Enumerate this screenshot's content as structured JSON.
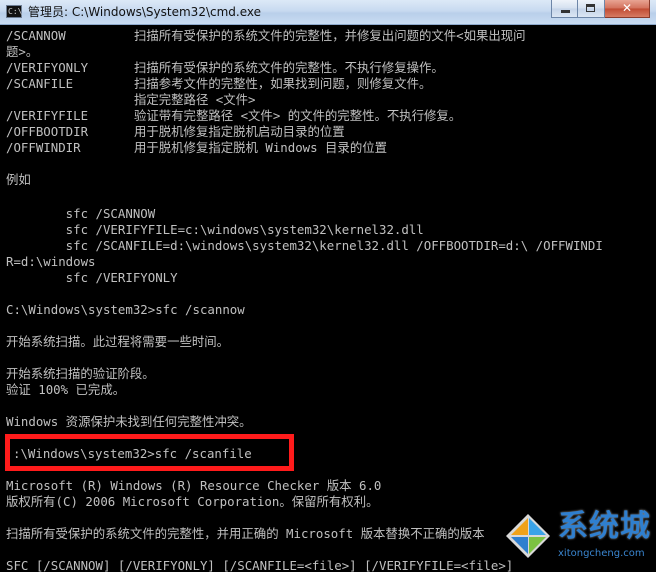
{
  "window": {
    "title": "管理员: C:\\Windows\\System32\\cmd.exe",
    "icon_label": "C:\\"
  },
  "console": {
    "options": [
      {
        "switch": "/SCANNOW",
        "desc": "扫描所有受保护的系统文件的完整性，并修复出问题的文件<如果出现问"
      },
      {
        "switch": "",
        "desc": "题>。"
      },
      {
        "switch": "/VERIFYONLY",
        "desc": "扫描所有受保护的系统文件的完整性。不执行修复操作。"
      },
      {
        "switch": "/SCANFILE",
        "desc": "扫描参考文件的完整性，如果找到问题，则修复文件。"
      },
      {
        "switch": "",
        "desc": "指定完整路径 <文件>"
      },
      {
        "switch": "/VERIFYFILE",
        "desc": "验证带有完整路径 <文件> 的文件的完整性。不执行修复。"
      },
      {
        "switch": "/OFFBOOTDIR",
        "desc": "用于脱机修复指定脱机启动目录的位置"
      },
      {
        "switch": "/OFFWINDIR",
        "desc": "用于脱机修复指定脱机 Windows 目录的位置"
      }
    ],
    "example_heading": "例如",
    "examples": [
      "        sfc /SCANNOW",
      "        sfc /VERIFYFILE=c:\\windows\\system32\\kernel32.dll",
      "        sfc /SCANFILE=d:\\windows\\system32\\kernel32.dll /OFFBOOTDIR=d:\\ /OFFWINDI",
      "R=d:\\windows",
      "        sfc /VERIFYONLY"
    ],
    "prompt1": "C:\\Windows\\system32>sfc /scannow",
    "scan_start": "开始系统扫描。此过程将需要一些时间。",
    "verify_phase": "开始系统扫描的验证阶段。",
    "verify_done": "验证 100% 已完成。",
    "result": "Windows 资源保护未找到任何完整性冲突。",
    "prompt2": ":\\Windows\\system32>sfc /scanfile",
    "rc_version": "Microsoft (R) Windows (R) Resource Checker 版本 6.0",
    "copyright": "版权所有(C) 2006 Microsoft Corporation。保留所有权利。",
    "desc_line": "扫描所有受保护的系统文件的完整性，并用正确的 Microsoft 版本替换不正确的版本",
    "usage_line": "SFC [/SCANNOW] [/VERIFYONLY] [/SCANFILE=<file>] [/VERIFYFILE=<file>]"
  },
  "colors": {
    "console_bg": "#000000",
    "console_fg": "#c0c0c0",
    "highlight": "#ff1b1b",
    "watermark": "#2f7fcf"
  },
  "watermark": {
    "brand": "系统城",
    "url": "xitongcheng.com",
    "logo_icon": "windows-flag-icon"
  }
}
